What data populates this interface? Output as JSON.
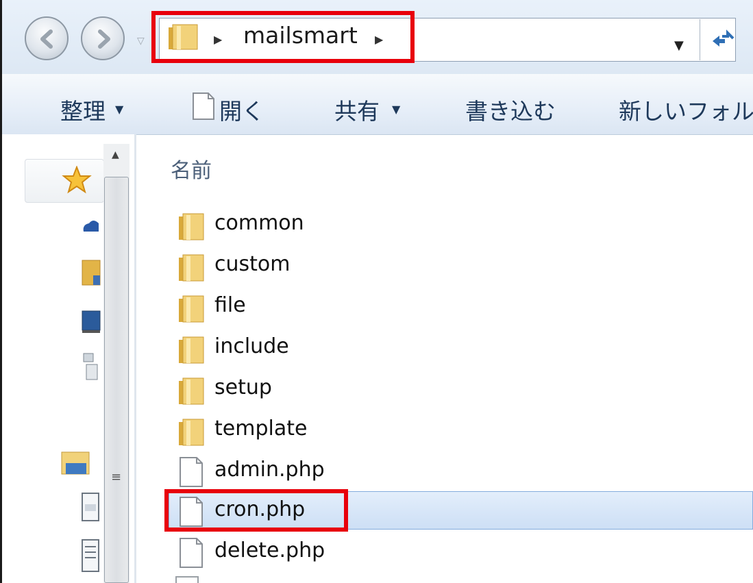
{
  "address_bar": {
    "path": "mailsmart"
  },
  "toolbar": {
    "organize_label": "整理",
    "open_label": "開く",
    "share_label": "共有",
    "burn_label": "書き込む",
    "new_folder_label": "新しいフォル"
  },
  "file_list": {
    "column_name": "名前",
    "items": [
      {
        "name": "common",
        "type": "folder"
      },
      {
        "name": "custom",
        "type": "folder"
      },
      {
        "name": "file",
        "type": "folder"
      },
      {
        "name": "include",
        "type": "folder"
      },
      {
        "name": "setup",
        "type": "folder"
      },
      {
        "name": "template",
        "type": "folder"
      },
      {
        "name": "admin.php",
        "type": "file"
      },
      {
        "name": "cron.php",
        "type": "file",
        "selected": true,
        "highlighted": true
      },
      {
        "name": "delete.php",
        "type": "file"
      }
    ]
  },
  "colors": {
    "highlight": "#e8000b",
    "selection": "#cddff5",
    "folder": "#e8c25a"
  }
}
